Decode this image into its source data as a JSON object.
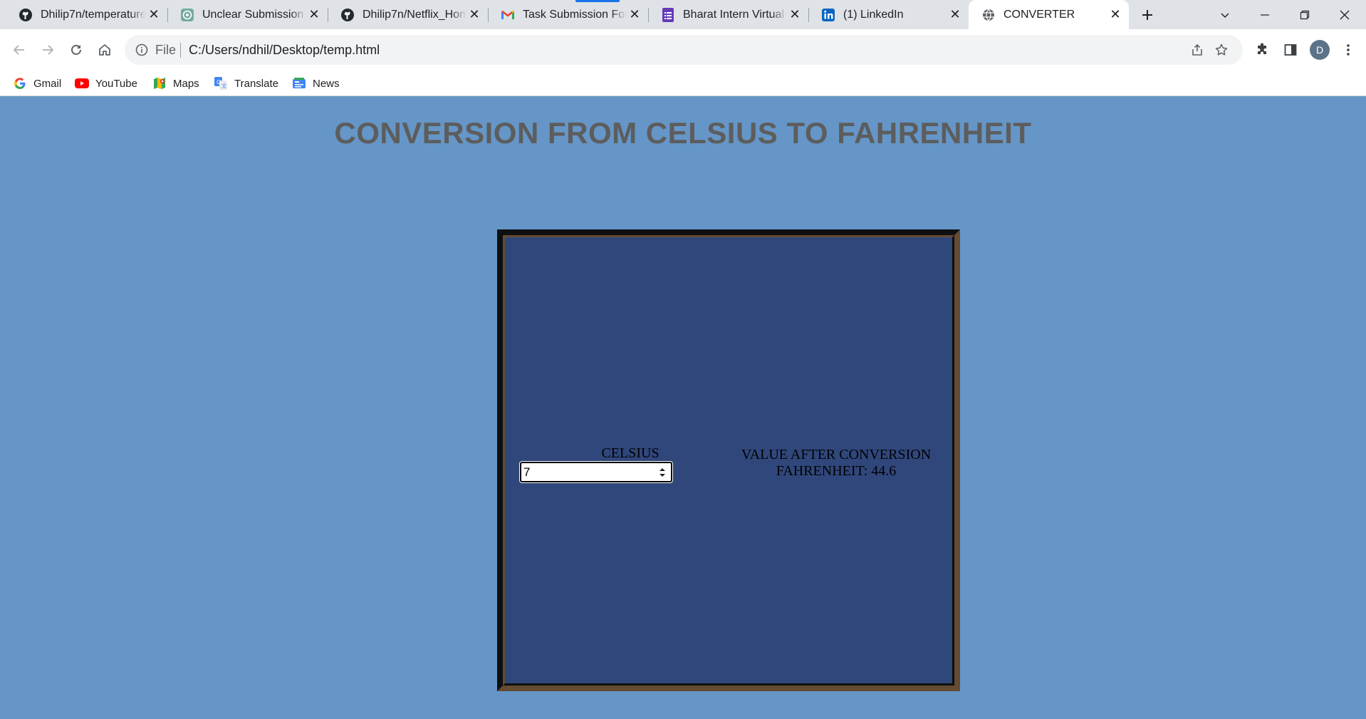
{
  "browser": {
    "tabs": [
      {
        "title": "Dhilip7n/temperature",
        "icon": "github-icon",
        "active": false
      },
      {
        "title": "Unclear Submission R",
        "icon": "chatgpt-icon",
        "active": false
      },
      {
        "title": "Dhilip7n/Netflix_Hom",
        "icon": "github-icon",
        "active": false
      },
      {
        "title": "Task Submission Form",
        "icon": "gmail-icon",
        "active": false
      },
      {
        "title": "Bharat Intern Virtual I",
        "icon": "google-forms-icon",
        "active": false
      },
      {
        "title": "(1) LinkedIn",
        "icon": "linkedin-icon",
        "active": false
      },
      {
        "title": "CONVERTER",
        "icon": "globe-icon",
        "active": true
      }
    ],
    "address": {
      "scheme_label": "File",
      "url": "C:/Users/ndhil/Desktop/temp.html"
    },
    "profile_initial": "D",
    "bookmarks": [
      {
        "label": "Gmail",
        "icon": "google-icon"
      },
      {
        "label": "YouTube",
        "icon": "youtube-icon"
      },
      {
        "label": "Maps",
        "icon": "maps-icon"
      },
      {
        "label": "Translate",
        "icon": "translate-icon"
      },
      {
        "label": "News",
        "icon": "news-icon"
      }
    ]
  },
  "page": {
    "title": "CONVERSION FROM CELSIUS TO FAHRENHEIT",
    "celsius_label": "CELSIUS",
    "celsius_value": "7",
    "result_heading": "VALUE AFTER CONVERSION",
    "result_text": "FAHRENHEIT: 44.6"
  },
  "colors": {
    "page_background": "#6596c7",
    "box_background": "#30477b",
    "title_text": "#5d5d5d",
    "box_border_dark": "#0e0f10",
    "box_border_brown": "#644b32"
  }
}
